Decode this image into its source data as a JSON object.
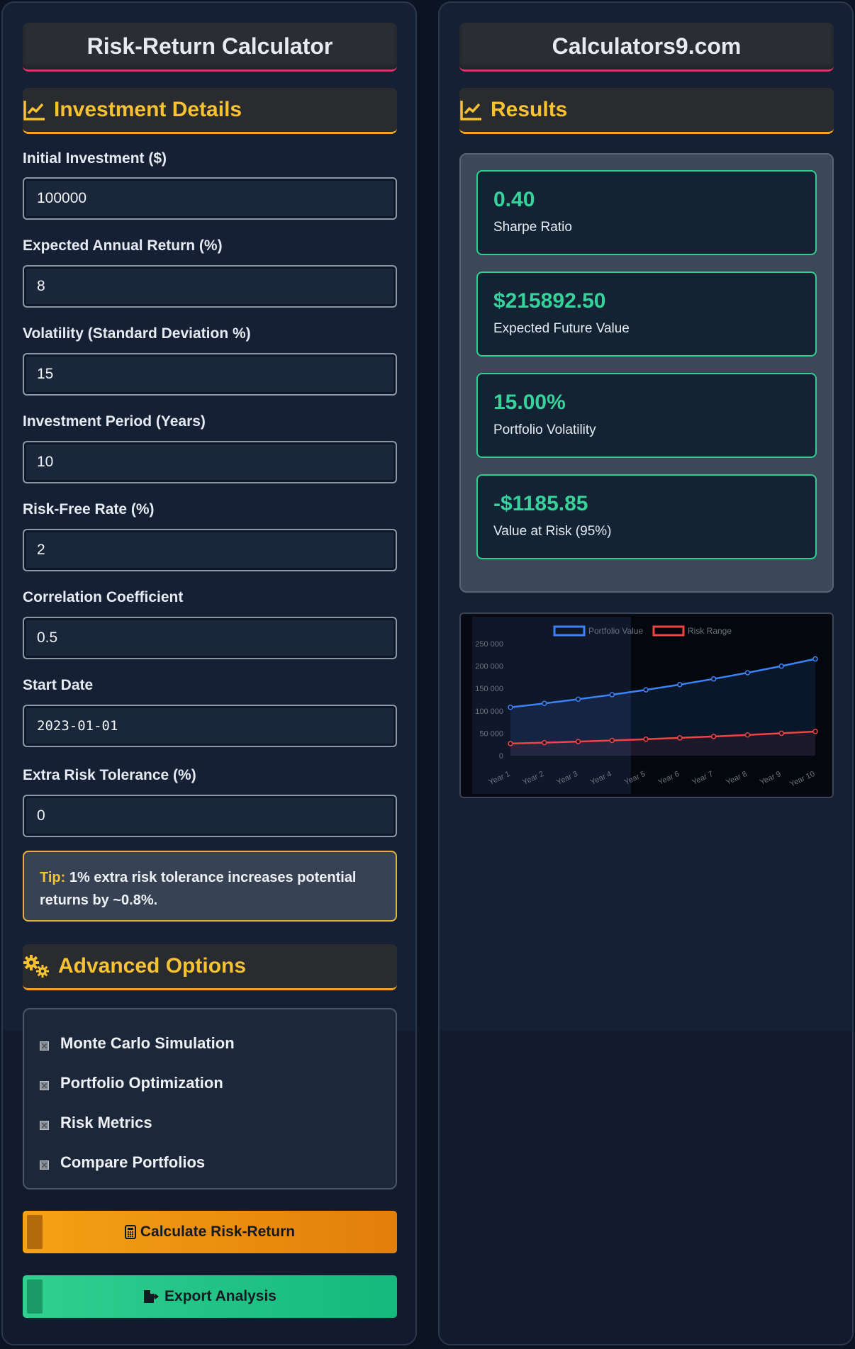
{
  "left": {
    "title": "Risk-Return Calculator",
    "investment_section": "Investment Details",
    "fields": [
      {
        "label": "Initial Investment ($)",
        "value": "100000"
      },
      {
        "label": "Expected Annual Return (%)",
        "value": "8"
      },
      {
        "label": "Volatility (Standard Deviation %)",
        "value": "15"
      },
      {
        "label": "Investment Period (Years)",
        "value": "10"
      },
      {
        "label": "Risk-Free Rate (%)",
        "value": "2"
      },
      {
        "label": "Correlation Coefficient",
        "value": "0.5"
      },
      {
        "label": "Start Date",
        "value": "2023-01-01"
      },
      {
        "label": "Extra Risk Tolerance (%)",
        "value": "0"
      }
    ],
    "tip": {
      "label": "Tip:",
      "text": " 1% extra risk tolerance increases potential returns by ~0.8%."
    },
    "advanced_section": "Advanced Options",
    "options": [
      "Monte Carlo Simulation",
      "Portfolio Optimization",
      "Risk Metrics",
      "Compare Portfolios"
    ],
    "calculate_label": "Calculate Risk-Return",
    "export_label": "Export Analysis"
  },
  "right": {
    "title": "Calculators9.com",
    "results_section": "Results",
    "results": [
      {
        "value": "0.40",
        "label": "Sharpe Ratio"
      },
      {
        "value": "$215892.50",
        "label": "Expected Future Value"
      },
      {
        "value": "15.00%",
        "label": "Portfolio Volatility"
      },
      {
        "value": "-$1185.85",
        "label": "Value at Risk (95%)"
      }
    ]
  },
  "colors": {
    "accent_orange": "#f7c232",
    "accent_green": "#35d29a",
    "title_underline": "#d6336c",
    "series_portfolio": "#3b82f6",
    "series_risk": "#ef4444"
  },
  "icons": {
    "section": "chart-line-icon",
    "advanced": "gears-icon",
    "calculate": "calculator-icon",
    "export": "file-export-icon"
  },
  "chart_data": {
    "type": "line",
    "categories": [
      "Year 1",
      "Year 2",
      "Year 3",
      "Year 4",
      "Year 5",
      "Year 6",
      "Year 7",
      "Year 8",
      "Year 9",
      "Year 10"
    ],
    "series": [
      {
        "name": "Portfolio Value",
        "values": [
          108000,
          116640,
          125971,
          136049,
          146933,
          158687,
          171382,
          185093,
          199900,
          215892
        ]
      },
      {
        "name": "Risk Range",
        "values": [
          27000,
          29160,
          31493,
          34012,
          36733,
          39672,
          42846,
          46273,
          49975,
          53973
        ]
      }
    ],
    "yticks": [
      "250 000",
      "200 000",
      "150 000",
      "100 000",
      "50 000",
      "0"
    ],
    "ylim": [
      0,
      250000
    ],
    "legend": "top",
    "grid": false
  }
}
